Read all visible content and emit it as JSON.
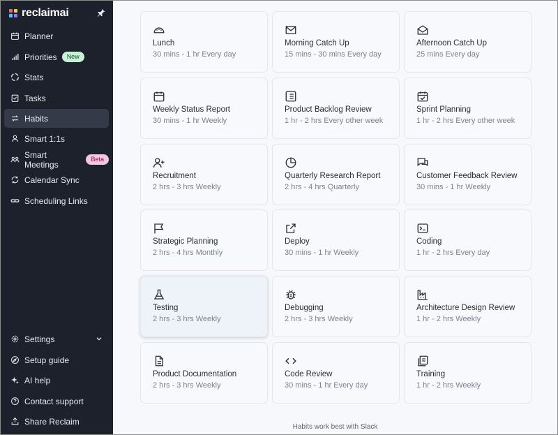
{
  "brand": {
    "name": "reclaimai"
  },
  "sidebar": {
    "items": [
      {
        "label": "Planner",
        "icon": "calendar-icon"
      },
      {
        "label": "Priorities",
        "icon": "bar-chart-icon",
        "badge": "New"
      },
      {
        "label": "Stats",
        "icon": "pie-icon"
      },
      {
        "label": "Tasks",
        "icon": "task-check-icon"
      },
      {
        "label": "Habits",
        "icon": "repeat-icon",
        "active": true
      },
      {
        "label": "Smart 1:1s",
        "icon": "users-icon"
      },
      {
        "label": "Smart Meetings",
        "icon": "group-icon",
        "badge": "Beta"
      },
      {
        "label": "Calendar Sync",
        "icon": "sync-icon"
      },
      {
        "label": "Scheduling Links",
        "icon": "link-icon"
      }
    ],
    "bottom_items": [
      {
        "label": "Settings",
        "icon": "gear-icon"
      },
      {
        "label": "Setup guide",
        "icon": "compass-icon"
      },
      {
        "label": "AI help",
        "icon": "sparkle-icon"
      },
      {
        "label": "Contact support",
        "icon": "help-circle-icon"
      },
      {
        "label": "Share Reclaim",
        "icon": "share-icon"
      }
    ]
  },
  "habits": [
    {
      "title": "Lunch",
      "subtitle": "30 mins - 1 hr Every day",
      "icon": "taco-icon"
    },
    {
      "title": "Morning Catch Up",
      "subtitle": "15 mins - 30 mins Every day",
      "icon": "mail-icon"
    },
    {
      "title": "Afternoon Catch Up",
      "subtitle": "25 mins Every day",
      "icon": "mail-open-icon"
    },
    {
      "title": " Weekly Status Report",
      "subtitle": "30 mins - 1 hr Weekly",
      "icon": "calendar-icon"
    },
    {
      "title": "Product Backlog Review",
      "subtitle": "1 hr - 2 hrs Every other week",
      "icon": "list-icon"
    },
    {
      "title": "Sprint Planning",
      "subtitle": "1 hr - 2 hrs Every other week",
      "icon": "calendar-check-icon"
    },
    {
      "title": " Recruitment",
      "subtitle": "2 hrs - 3 hrs Weekly",
      "icon": "user-plus-icon"
    },
    {
      "title": "Quarterly Research Report",
      "subtitle": "2 hrs - 4 hrs Quarterly",
      "icon": "pie-chart-icon"
    },
    {
      "title": "Customer Feedback Review",
      "subtitle": "30 mins - 1 hr Weekly",
      "icon": "chat-bubbles-icon"
    },
    {
      "title": "Strategic Planning",
      "subtitle": "2 hrs - 4 hrs Monthly",
      "icon": "flag-icon"
    },
    {
      "title": "Deploy",
      "subtitle": "30 mins - 1 hr Weekly",
      "icon": "external-link-icon"
    },
    {
      "title": "Coding",
      "subtitle": "1 hr - 2 hrs Every day",
      "icon": "terminal-icon"
    },
    {
      "title": "Testing",
      "subtitle": "2 hrs - 3 hrs Weekly",
      "icon": "flask-icon"
    },
    {
      "title": "Debugging",
      "subtitle": "2 hrs - 3 hrs Weekly",
      "icon": "bug-icon"
    },
    {
      "title": "Architecture Design Review",
      "subtitle": "1 hr - 2 hrs Weekly",
      "icon": "factory-icon"
    },
    {
      "title": "Product Documentation",
      "subtitle": "2 hrs - 3 hrs Weekly",
      "icon": "document-icon"
    },
    {
      "title": "Code Review",
      "subtitle": "30 mins - 1 hr Every day",
      "icon": "code-icon"
    },
    {
      "title": "Training",
      "subtitle": "1 hr - 2 hrs Weekly",
      "icon": "notebook-icon"
    }
  ],
  "footer": {
    "note": "Habits work best with Slack"
  },
  "colors": {
    "sidebar_bg": "#1c212c",
    "active_item": "#343a47",
    "badge_new": "#c9f1d8",
    "badge_beta": "#f7c5dd",
    "main_bg": "#f7f8fb"
  }
}
